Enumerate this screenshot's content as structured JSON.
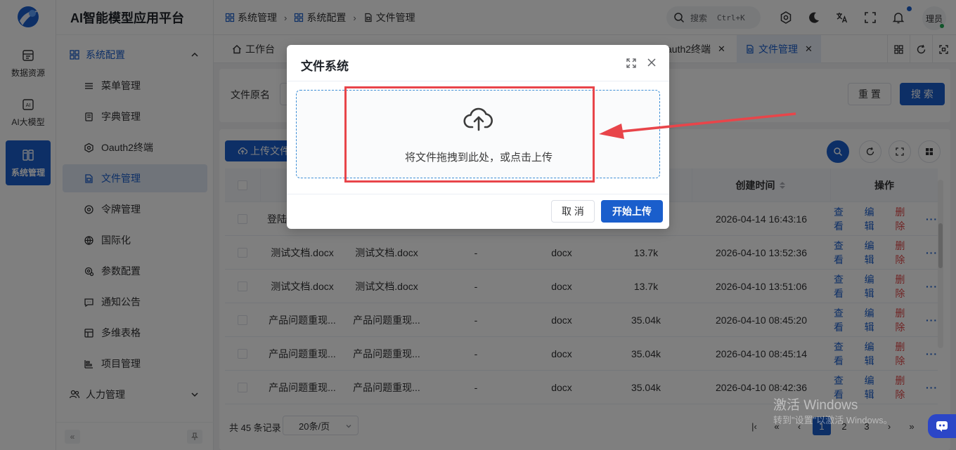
{
  "app": {
    "title": "AI智能模型应用平台"
  },
  "rail": [
    {
      "label": "数据资源",
      "icon": "database-icon"
    },
    {
      "label": "AI大模型",
      "icon": "ai-icon"
    },
    {
      "label": "系统管理",
      "icon": "system-icon",
      "active": true
    }
  ],
  "menu": {
    "group": "系统配置",
    "items": [
      {
        "label": "菜单管理",
        "icon": "list-icon"
      },
      {
        "label": "字典管理",
        "icon": "book-icon"
      },
      {
        "label": "Oauth2终端",
        "icon": "hexagon-icon"
      },
      {
        "label": "文件管理",
        "icon": "file-icon",
        "active": true
      },
      {
        "label": "令牌管理",
        "icon": "token-icon"
      },
      {
        "label": "国际化",
        "icon": "globe-icon"
      },
      {
        "label": "参数配置",
        "icon": "settings-icon"
      },
      {
        "label": "通知公告",
        "icon": "message-icon"
      },
      {
        "label": "多维表格",
        "icon": "table-icon"
      },
      {
        "label": "项目管理",
        "icon": "project-icon"
      }
    ],
    "group2": "人力管理"
  },
  "breadcrumb": [
    "系统管理",
    "系统配置",
    "文件管理"
  ],
  "header": {
    "search_label": "搜索",
    "shortcut": "Ctrl+K",
    "avatar_text": "理员"
  },
  "tabs": [
    {
      "label": "工作台",
      "closable": false
    },
    {
      "label": "auth2终端",
      "closable": true
    },
    {
      "label": "文件管理",
      "closable": true,
      "active": true
    }
  ],
  "search_form": {
    "label": "文件原名",
    "reset": "重 置",
    "search": "搜 索"
  },
  "toolbar": {
    "upload": "上传文件"
  },
  "table": {
    "columns": {
      "created": "创建时间",
      "actions": "操作"
    },
    "actions": {
      "view": "查看",
      "edit": "编辑",
      "delete": "删除",
      "more": "···"
    },
    "rows": [
      {
        "name": "登陆",
        "original": "",
        "path": "",
        "type": "",
        "size": "",
        "created": "2026-04-14 16:43:16"
      },
      {
        "name": "测试文档.docx",
        "original": "测试文档.docx",
        "path": "-",
        "type": "docx",
        "size": "13.7k",
        "created": "2026-04-10 13:52:36"
      },
      {
        "name": "测试文档.docx",
        "original": "测试文档.docx",
        "path": "-",
        "type": "docx",
        "size": "13.7k",
        "created": "2026-04-10 13:51:06"
      },
      {
        "name": "产品问题重现...",
        "original": "产品问题重现...",
        "path": "-",
        "type": "docx",
        "size": "35.04k",
        "created": "2026-04-10 08:45:20"
      },
      {
        "name": "产品问题重现...",
        "original": "产品问题重现...",
        "path": "-",
        "type": "docx",
        "size": "35.04k",
        "created": "2026-04-10 08:45:14"
      },
      {
        "name": "产品问题重现...",
        "original": "产品问题重现...",
        "path": "-",
        "type": "docx",
        "size": "35.04k",
        "created": "2026-04-10 08:42:36"
      }
    ]
  },
  "pager": {
    "total": "共 45 条记录",
    "page_size": "20条/页",
    "pages": [
      "1",
      "2",
      "3"
    ],
    "current": "1"
  },
  "dialog": {
    "title": "文件系统",
    "drop_text": "将文件拖拽到此处，或点击上传",
    "cancel": "取 消",
    "confirm": "开始上传"
  },
  "watermark": {
    "line1": "激活 Windows",
    "line2": "转到\"设置\"以激活 Windows。"
  },
  "colors": {
    "primary": "#1a5ecc",
    "danger": "#e04848",
    "annotation": "#e8454a"
  }
}
